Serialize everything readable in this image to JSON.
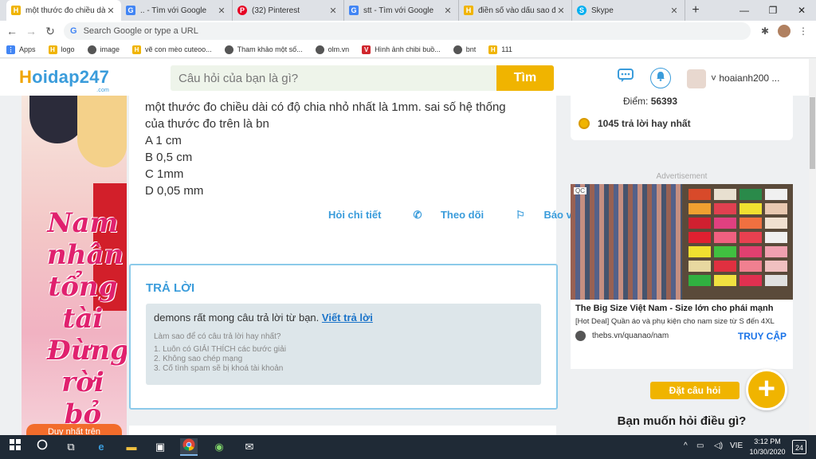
{
  "browser": {
    "tabs": [
      {
        "title": "một thước đo chiều dài",
        "favicon": "H",
        "favicon_color": "#f0b400"
      },
      {
        "title": ".. - Tìm với Google",
        "favicon": "G",
        "favicon_color": "#4285f4"
      },
      {
        "title": "(32) Pinterest",
        "favicon": "P",
        "favicon_color": "#e60023"
      },
      {
        "title": "stt - Tìm với Google",
        "favicon": "G",
        "favicon_color": "#4285f4"
      },
      {
        "title": "điền số vào dấu sao để",
        "favicon": "H",
        "favicon_color": "#f0b400"
      },
      {
        "title": "Skype",
        "favicon": "S",
        "favicon_color": "#00aff0"
      }
    ],
    "new_tab": "+",
    "window_controls": {
      "minimize": "—",
      "restore": "❐",
      "close": "✕"
    },
    "omnibox_placeholder": "Search Google or type a URL",
    "nav": {
      "back": "←",
      "forward": "→",
      "reload": "↻"
    },
    "bookmarks": [
      {
        "label": "Apps",
        "icon": "apps-icon",
        "icon_glyph": "⋮⋮",
        "color": "#4285f4"
      },
      {
        "label": "logo",
        "icon": "hoidap-icon",
        "icon_glyph": "H",
        "color": "#f0b400"
      },
      {
        "label": "image",
        "icon": "globe-icon",
        "icon_glyph": "◉",
        "color": "#555555"
      },
      {
        "label": "vẽ con mèo cuteoo...",
        "icon": "hoidap-icon",
        "icon_glyph": "H",
        "color": "#f0b400"
      },
      {
        "label": "Tham khảo một số...",
        "icon": "globe-icon",
        "icon_glyph": "◉",
        "color": "#555555"
      },
      {
        "label": "olm.vn",
        "icon": "globe-icon",
        "icon_glyph": "◉",
        "color": "#555555"
      },
      {
        "label": "Hình ảnh chibi buồ...",
        "icon": "v-icon",
        "icon_glyph": "V",
        "color": "#d0262d"
      },
      {
        "label": "bnt",
        "icon": "globe-icon",
        "icon_glyph": "◉",
        "color": "#555555"
      },
      {
        "label": "111",
        "icon": "hoidap-icon",
        "icon_glyph": "H",
        "color": "#f0b400"
      }
    ]
  },
  "site": {
    "logo_main": "oidap247",
    "logo_h": "H",
    "logo_com": ".com",
    "search_placeholder": "Câu hỏi của bạn là gì?",
    "search_button": "Tìm",
    "username": "hoaianh200 ..."
  },
  "left_ad": {
    "title_text": "Nam nhân tổng tài Đừng rời bỏ tôi",
    "cta": "Duy nhất trên"
  },
  "question": {
    "lines": [
      "một thước đo chiều dài có độ chia nhỏ nhất là 1mm. sai số hệ thống",
      "của thước đo trên là bn",
      "A 1 cm",
      "B 0,5 cm",
      "C 1mm",
      "D 0,05 mm"
    ],
    "actions": {
      "detail": "Hỏi chi tiết",
      "follow": "Theo dõi",
      "report": "Báo vi phạm"
    }
  },
  "answer": {
    "title": "TRẢ LỜI",
    "prompt": "demons rất mong câu trả lời từ bạn.",
    "write_link": "Viết trả lời",
    "tips_title": "Làm sao để có câu trả lời hay nhất?",
    "tips": [
      "1. Luôn có GIẢI THÍCH các bước giải",
      "2. Không sao chép mạng",
      "3. Cố tình spam sẽ bị khoá tài khoản"
    ]
  },
  "stats": {
    "points_label": "Điểm:",
    "points_value": "56393",
    "best_answers": "1045 trả lời hay nhất"
  },
  "right_ad": {
    "label": "Advertisement",
    "qc": "QC",
    "headline": "The Big Size Việt Nam - Size lớn cho phái mạnh",
    "desc": "[Hot Deal] Quần áo và phụ kiện cho nam size từ S đến 4XL",
    "domain": "thebs.vn/quanao/nam",
    "cta": "TRUY CẬP"
  },
  "ask": {
    "button": "Đặt câu hỏi",
    "plus": "+",
    "question": "Bạn muốn hỏi điều gì?"
  },
  "taskbar": {
    "lang": "VIE",
    "time": "3:12 PM",
    "date": "10/30/2020",
    "notifications": "24",
    "chevron": "^"
  },
  "colors": {
    "accent_blue": "#3a9cdb",
    "accent_yellow": "#f0b400"
  }
}
